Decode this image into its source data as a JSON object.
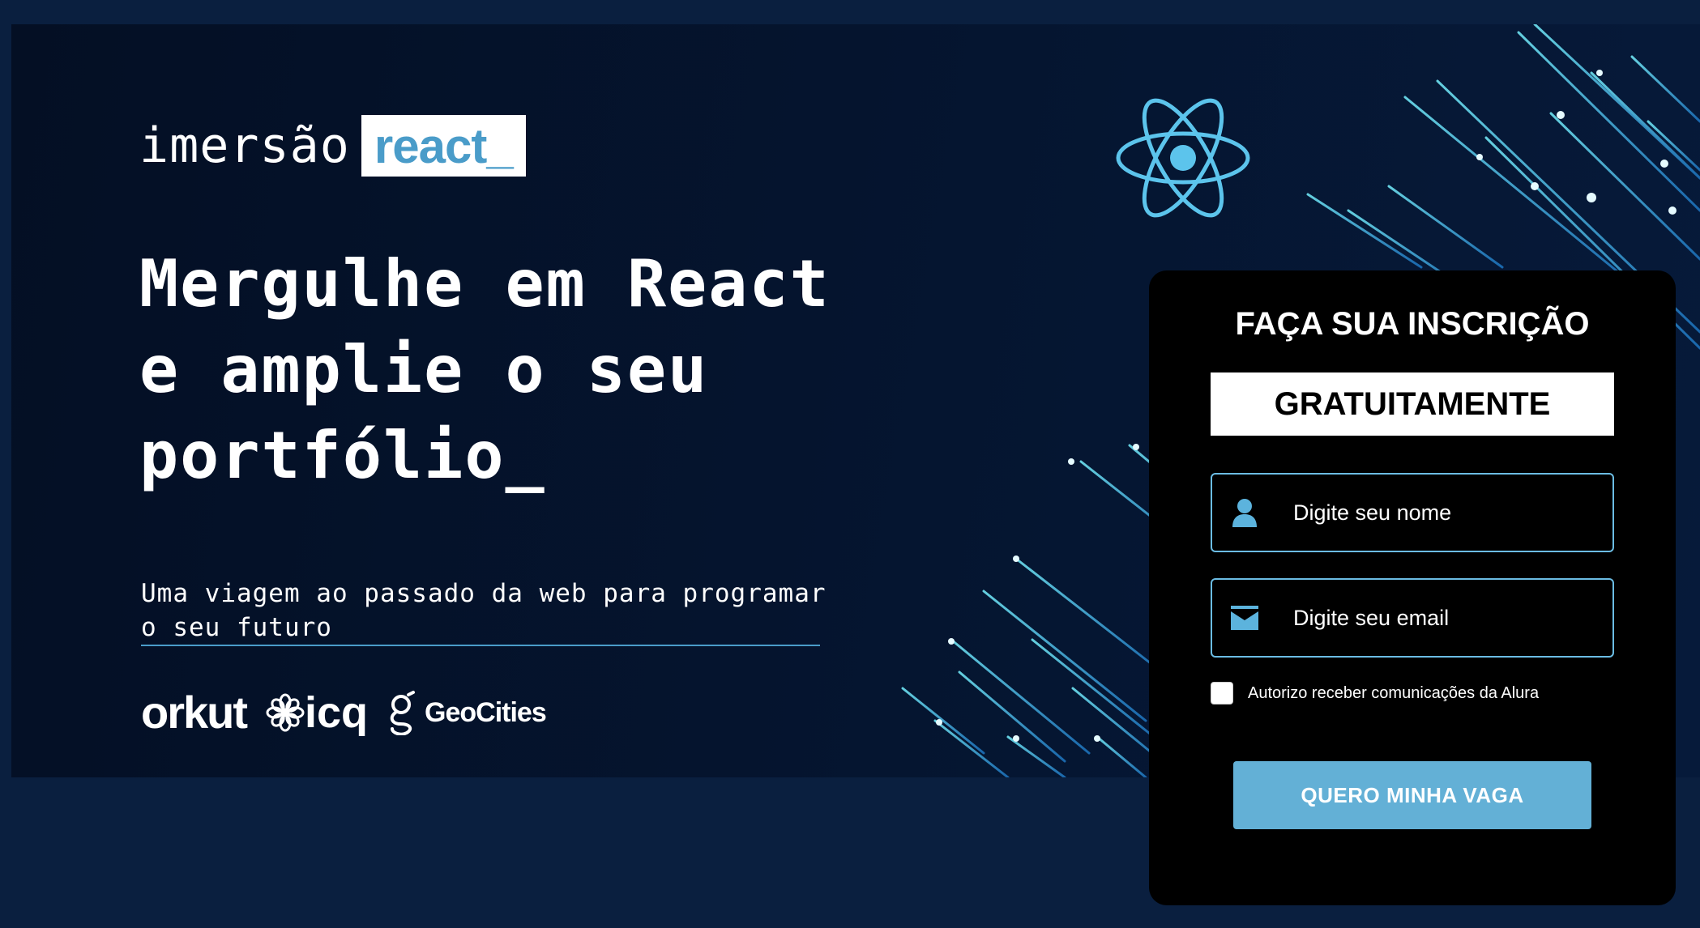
{
  "brand": {
    "imersao": "imersão",
    "react": "react_"
  },
  "hero": {
    "headline_lines": [
      "Mergulhe em React",
      "e amplie o seu",
      "portfólio_"
    ],
    "subtitle_lines": [
      "Uma viagem ao passado da web para programar",
      "o seu futuro"
    ]
  },
  "partners": {
    "orkut": "orkut",
    "icq": "icq",
    "geocities": "GeoCities"
  },
  "form": {
    "title": "FAÇA SUA INSCRIÇÃO",
    "badge": "GRATUITAMENTE",
    "name_placeholder": "Digite seu nome",
    "email_placeholder": "Digite seu email",
    "consent_label": "Autorizo receber comunicações da Alura",
    "consent_checked": false,
    "submit_label": "QUERO MINHA VAGA"
  },
  "colors": {
    "page_background": "#0a1f3f",
    "hero_background": "#051530",
    "accent": "#63b0d6",
    "panel_background": "#000000"
  },
  "icons": [
    "react-logo-icon",
    "user-icon",
    "mail-icon",
    "flower-icon",
    "geocities-icon"
  ]
}
